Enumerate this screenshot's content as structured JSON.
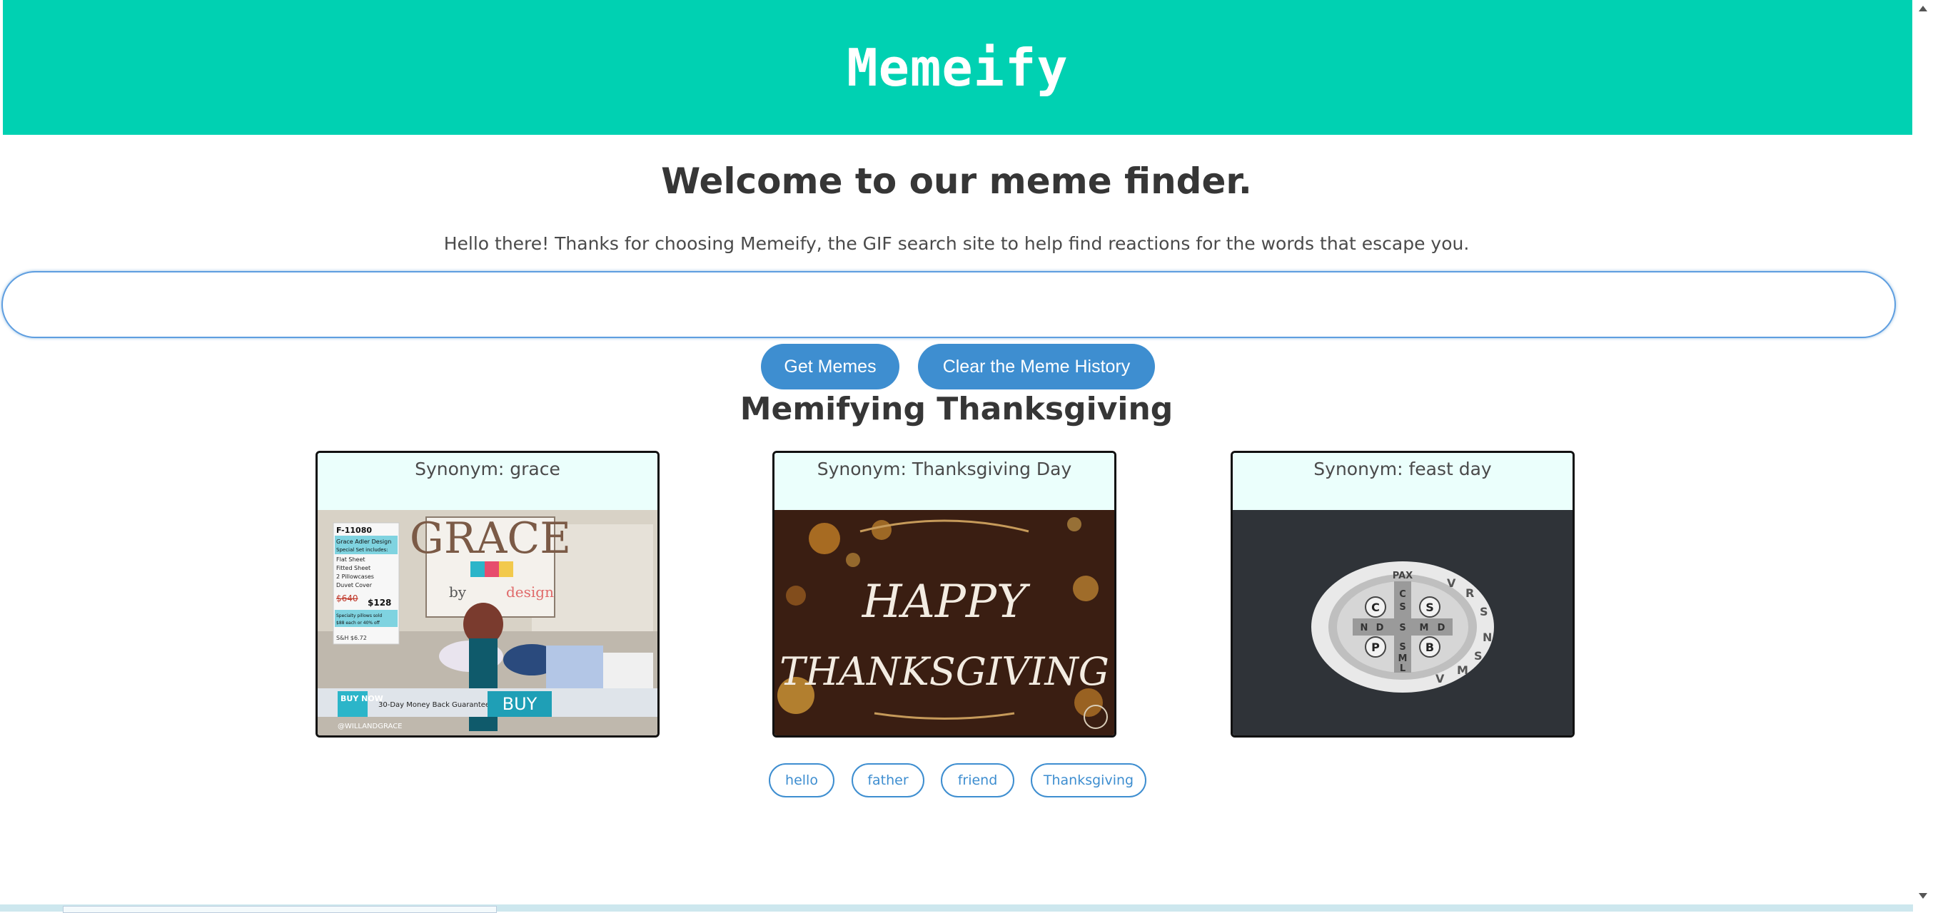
{
  "header": {
    "title": "Memeify"
  },
  "welcome": {
    "heading": "Welcome to our meme finder.",
    "intro": "Hello there! Thanks for choosing Memeify, the GIF search site to help find reactions for the words that escape you."
  },
  "search": {
    "value": "",
    "placeholder": ""
  },
  "buttons": {
    "get_memes": "Get Memes",
    "clear_history": "Clear the Meme History"
  },
  "results": {
    "title": "Memifying Thanksgiving",
    "cards": [
      {
        "label": "Synonym: grace"
      },
      {
        "label": "Synonym: Thanksgiving Day"
      },
      {
        "label": "Synonym: feast day"
      }
    ]
  },
  "gif_text": {
    "grace": {
      "sign": "GRACE",
      "byline": "by",
      "byline_rest": "design",
      "item_code": "F-11080",
      "product_lines": [
        "Grace Adler Design",
        "Special Set includes:",
        "Flat Sheet",
        "Fitted Sheet",
        "2 Pillowcases",
        "Duvet Cover"
      ],
      "old_price": "$640",
      "new_price": "$128",
      "price_note": "Specialty pillows sold",
      "price_note_2": "$88 each or 40% off",
      "sale_price": "S&H $6.72",
      "buy_now": "BUY NOW",
      "guarantee": "30-Day Money Back Guarantee",
      "buy": "BUY",
      "handle": "@WILLANDGRACE"
    },
    "thanksgiving": {
      "line1": "HAPPY",
      "line2": "THANKSGIVING"
    },
    "medal": {
      "ring_letters": [
        "V",
        "R",
        "S",
        "N",
        "S",
        "M",
        "V"
      ],
      "pax": "PAX",
      "cross_vertical": [
        "C",
        "S",
        "S",
        "M",
        "L"
      ],
      "cross_horizontal": [
        "N",
        "D",
        "S",
        "M",
        "D"
      ],
      "corners": [
        "C",
        "S",
        "P",
        "B"
      ]
    }
  },
  "history_tags": [
    "hello",
    "father",
    "friend",
    "Thanksgiving"
  ],
  "colors": {
    "header": "#00d1b2",
    "button": "#3e8ed0",
    "card_head": "#ebfffc"
  }
}
